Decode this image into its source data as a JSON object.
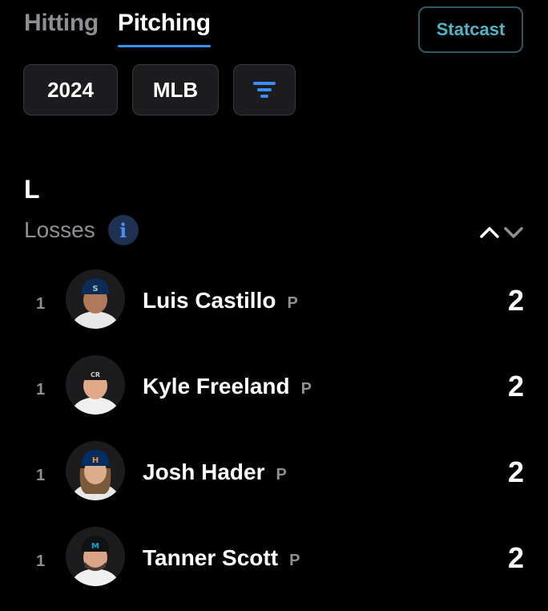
{
  "tabs": [
    {
      "label": "Hitting",
      "active": false
    },
    {
      "label": "Pitching",
      "active": true
    }
  ],
  "statcast_label": "Statcast",
  "filters": {
    "year": "2024",
    "league": "MLB",
    "filter_icon": "filter-icon"
  },
  "section_letter": "L",
  "stat": {
    "label": "Losses",
    "info_icon": "info-icon",
    "sort_icon": "sort-chevrons-icon"
  },
  "rows": [
    {
      "rank": "1",
      "name": "Luis Castillo",
      "position": "P",
      "value": "2",
      "team_color": "#0c2c56",
      "cap_logo": "S"
    },
    {
      "rank": "1",
      "name": "Kyle Freeland",
      "position": "P",
      "value": "2",
      "team_color": "#1a1a1a",
      "cap_logo": "CR"
    },
    {
      "rank": "1",
      "name": "Josh Hader",
      "position": "P",
      "value": "2",
      "team_color": "#002d62",
      "cap_logo": "H"
    },
    {
      "rank": "1",
      "name": "Tanner Scott",
      "position": "P",
      "value": "2",
      "team_color": "#111111",
      "cap_logo": "M"
    }
  ],
  "colors": {
    "accent": "#3a8df2",
    "statcast": "#4fb5c6",
    "muted": "#8e8e93"
  }
}
